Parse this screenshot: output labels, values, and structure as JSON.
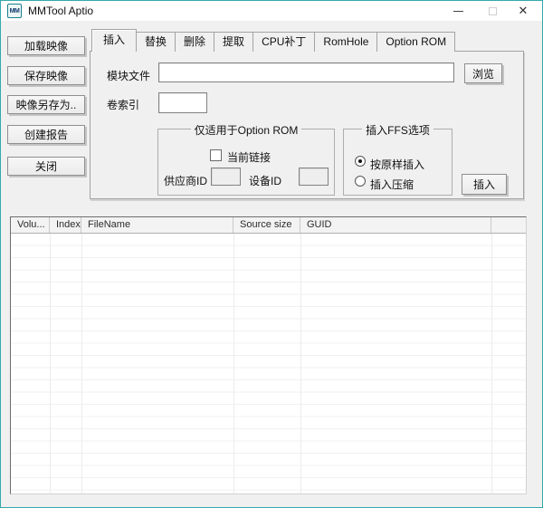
{
  "window": {
    "title": "MMTool Aptio",
    "icon_text": "MM",
    "close_glyph": "✕",
    "border_color": "#35a9ab"
  },
  "sidebar": {
    "buttons": [
      {
        "label": "加载映像"
      },
      {
        "label": "保存映像"
      },
      {
        "label": "映像另存为.."
      },
      {
        "label": "创建报告"
      },
      {
        "label": "关闭"
      }
    ]
  },
  "tabs": [
    {
      "label": "插入",
      "active": true
    },
    {
      "label": "替换",
      "active": false
    },
    {
      "label": "删除",
      "active": false
    },
    {
      "label": "提取",
      "active": false
    },
    {
      "label": "CPU补丁",
      "active": false
    },
    {
      "label": "RomHole",
      "active": false
    },
    {
      "label": "Option ROM",
      "active": false
    }
  ],
  "insert_tab": {
    "module_file_label": "模块文件",
    "module_file_value": "",
    "browse_label": "浏览",
    "volume_index_label": "卷索引",
    "volume_index_value": "",
    "option_rom_group": {
      "title": "仅适用于Option ROM",
      "current_link_label": "当前链接",
      "current_link_checked": false,
      "vendor_id_label": "供应商ID",
      "vendor_id_value": "",
      "device_id_label": "设备ID",
      "device_id_value": ""
    },
    "ffs_group": {
      "title": "插入FFS选项",
      "options": [
        {
          "label": "按原样插入",
          "selected": true
        },
        {
          "label": "插入压缩",
          "selected": false
        }
      ]
    },
    "insert_button_label": "插入"
  },
  "table": {
    "columns": [
      "Volu...",
      "Index",
      "FileName",
      "Source size",
      "GUID",
      ""
    ],
    "rows": []
  }
}
